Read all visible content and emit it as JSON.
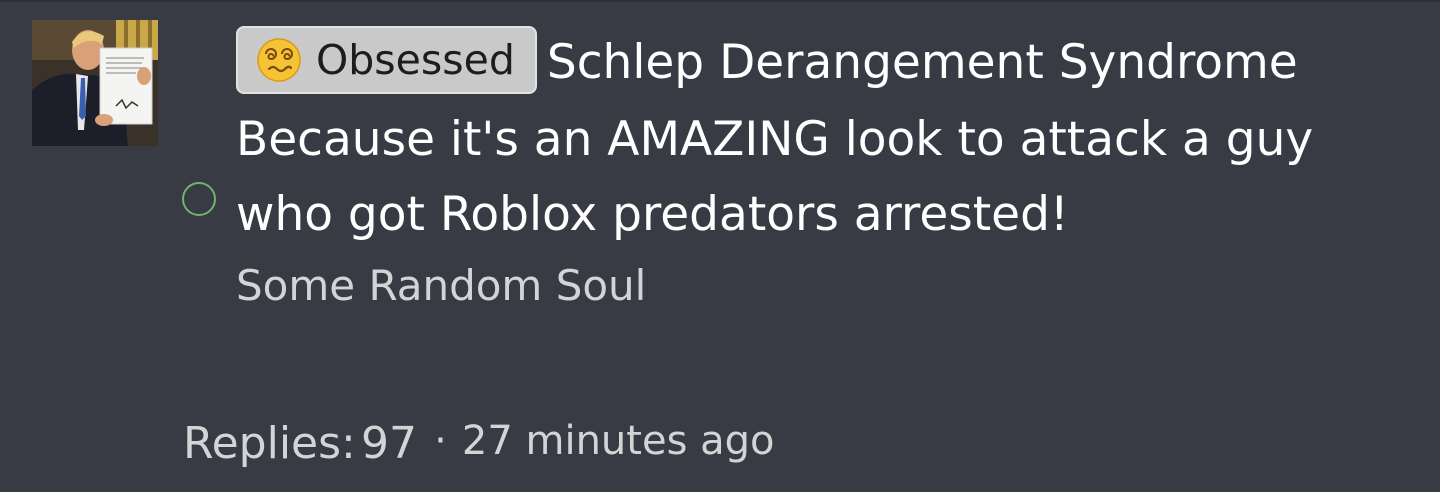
{
  "post": {
    "flair": {
      "label": "Obsessed",
      "icon": "dizzy-face-emoji"
    },
    "title": "Schlep Derangement Syndrome",
    "body": "Because it's an AMAZING look to attack a guy who got Roblox predators arrested!",
    "author": "Some Random Soul",
    "replies_label": "Replies:",
    "replies_count": "97",
    "separator": "·",
    "timestamp": "27 minutes ago",
    "status_color": "#6fb46a"
  }
}
